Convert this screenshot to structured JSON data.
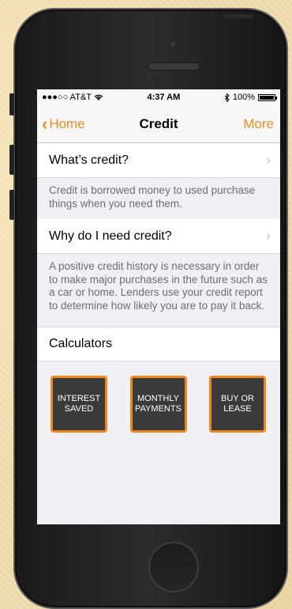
{
  "status": {
    "carrier": "●●●○○ AT&T",
    "wifi_icon": "wifi-icon",
    "time": "4:37 AM",
    "bluetooth_icon": "bluetooth-icon",
    "battery": "100%"
  },
  "nav": {
    "back_label": "Home",
    "title": "Credit",
    "right_label": "More"
  },
  "items": [
    {
      "title": "What’s credit?",
      "description": "Credit is borrowed money to used purchase things when you need them."
    },
    {
      "title": "Why do I need credit?",
      "description": "A positive credit history is necessary in order to make major purchases in the future such as a car or home. Lenders use your credit report to determine how likely you are to pay it back."
    }
  ],
  "calculators": {
    "title": "Calculators",
    "buttons": [
      {
        "line1": "Interest",
        "line2": "Saved"
      },
      {
        "line1": "Monthly",
        "line2": "Payments"
      },
      {
        "line1": "Buy or",
        "line2": "Lease"
      }
    ]
  },
  "colors": {
    "accent": "#f58a1f",
    "button_bg": "#3a3a3a",
    "button_border": "#f0871c"
  }
}
